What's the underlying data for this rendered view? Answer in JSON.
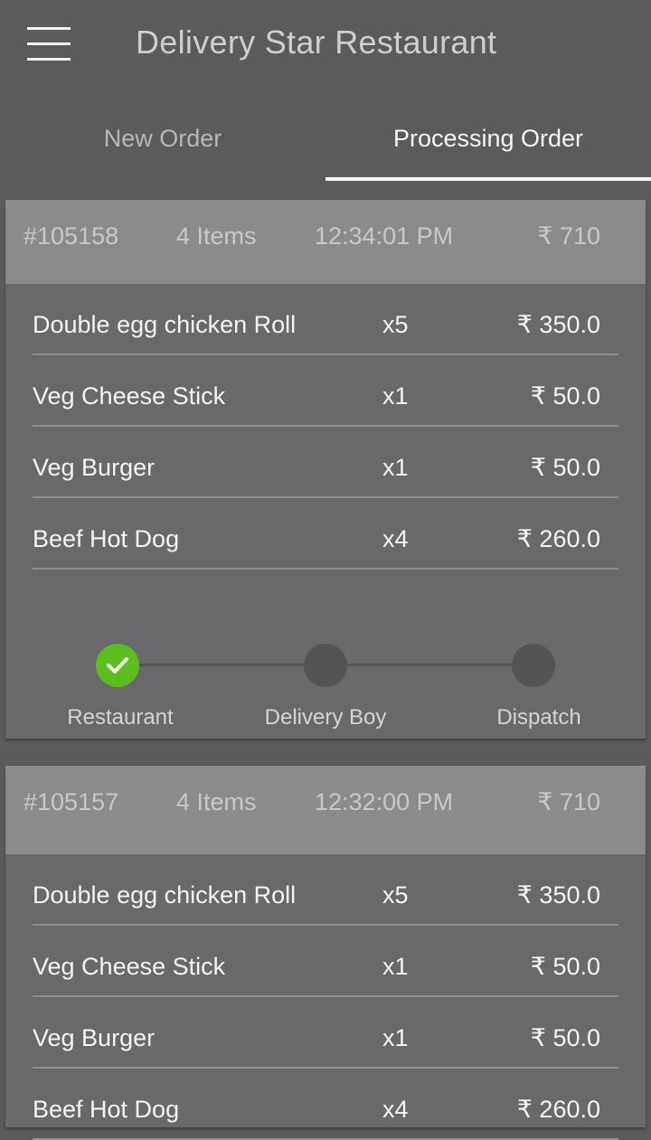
{
  "app": {
    "title": "Delivery Star Restaurant"
  },
  "tabs": [
    {
      "label": "New Order",
      "active": false
    },
    {
      "label": "Processing Order",
      "active": true
    }
  ],
  "colors": {
    "background": "#5a5b5d",
    "card_header": "#8a8b8d",
    "card_body": "#69696b",
    "step_done": "#5cbe1e",
    "step_pending": "#545456"
  },
  "orders": [
    {
      "id": "#105158",
      "items_count": "4 Items",
      "time": "12:34:01 PM",
      "total": "₹ 710",
      "items": [
        {
          "name": "Double egg chicken Roll",
          "qty": "x5",
          "price": "₹ 350.0"
        },
        {
          "name": "Veg Cheese Stick",
          "qty": "x1",
          "price": "₹ 50.0"
        },
        {
          "name": "Veg Burger",
          "qty": "x1",
          "price": "₹ 50.0"
        },
        {
          "name": "Beef Hot Dog",
          "qty": "x4",
          "price": "₹ 260.0"
        }
      ],
      "steps": [
        {
          "label": "Restaurant",
          "done": true,
          "icon": "check-icon"
        },
        {
          "label": "Delivery Boy",
          "done": false
        },
        {
          "label": "Dispatch",
          "done": false
        }
      ]
    },
    {
      "id": "#105157",
      "items_count": "4 Items",
      "time": "12:32:00 PM",
      "total": "₹ 710",
      "items": [
        {
          "name": "Double egg chicken Roll",
          "qty": "x5",
          "price": "₹ 350.0"
        },
        {
          "name": "Veg Cheese Stick",
          "qty": "x1",
          "price": "₹ 50.0"
        },
        {
          "name": "Veg Burger",
          "qty": "x1",
          "price": "₹ 50.0"
        },
        {
          "name": "Beef Hot Dog",
          "qty": "x4",
          "price": "₹ 260.0"
        }
      ]
    }
  ]
}
